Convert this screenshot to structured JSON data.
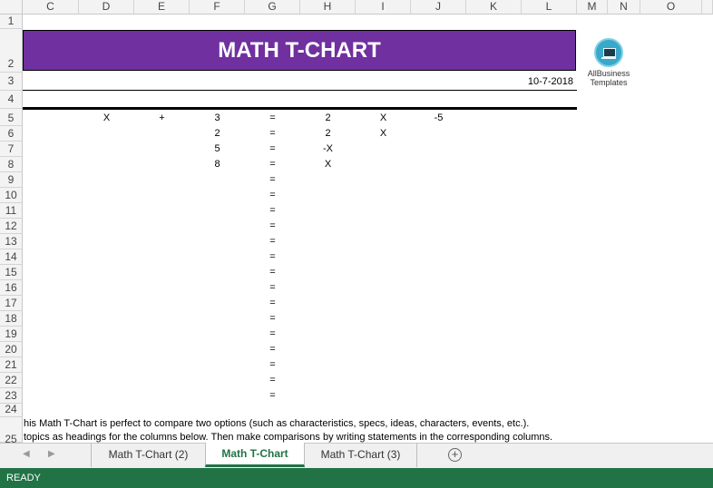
{
  "columns": [
    "C",
    "D",
    "E",
    "F",
    "G",
    "H",
    "I",
    "J",
    "K",
    "L",
    "M",
    "N",
    "O"
  ],
  "rows": [
    "1",
    "2",
    "3",
    "4",
    "5",
    "6",
    "7",
    "8",
    "9",
    "10",
    "11",
    "12",
    "13",
    "14",
    "15",
    "16",
    "17",
    "18",
    "19",
    "20",
    "21",
    "22",
    "23",
    "24",
    "25"
  ],
  "title": "MATH T-CHART",
  "date": "10-7-2018",
  "logo": {
    "line1": "AllBusiness",
    "line2": "Templates",
    "icon": "laptop-icon"
  },
  "row5": {
    "d": "X",
    "e": "+",
    "f": "3",
    "g": "=",
    "h": "2",
    "i": "X",
    "j": "-5"
  },
  "row6": {
    "f": "2",
    "g": "=",
    "h": "2",
    "i": "X"
  },
  "row7": {
    "f": "5",
    "g": "=",
    "h": "-X"
  },
  "row8": {
    "f": "8",
    "g": "=",
    "h": "X"
  },
  "equals": [
    "=",
    "=",
    "=",
    "=",
    "=",
    "=",
    "=",
    "=",
    "=",
    "=",
    "=",
    "=",
    "=",
    "=",
    "="
  ],
  "note_line1": "his Math T-Chart is perfect to compare two options (such as characteristics, specs, ideas, characters, events, etc.).",
  "note_line2": " topics as headings for the columns below. Then make comparisons by writing statements in the corresponding columns.",
  "tabs": [
    "Math T-Chart (2)",
    "Math T-Chart",
    "Math T-Chart (3)"
  ],
  "nav": {
    "prev": "◀",
    "next": "▶",
    "add": "+"
  },
  "status": "READY",
  "colors": {
    "title_band": "#7030a0",
    "status_bar": "#217346"
  }
}
